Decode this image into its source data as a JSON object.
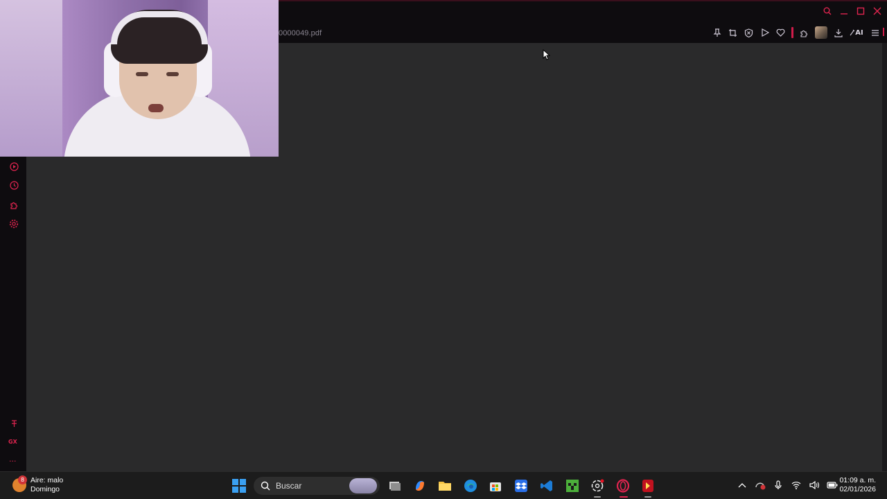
{
  "browser": {
    "address": {
      "url_text": "0000049.pdf"
    },
    "toolbar": {
      "icons": [
        "pin-icon",
        "snapshot-icon",
        "shield-icon",
        "play-icon",
        "heart-icon",
        "extensions-icon",
        "profile-avatar",
        "download-icon"
      ],
      "ai_label": "AI"
    },
    "sidebar": {
      "icons": [
        "player-icon",
        "history-icon",
        "extensions-icon",
        "settings-icon"
      ],
      "bottom_label": "GX",
      "more": "..."
    },
    "accent_color": "#e0244f",
    "viewport_color": "#2a2a2b"
  },
  "taskbar": {
    "weather": {
      "badge": "8",
      "line1": "Aire: malo",
      "line2": "Domingo"
    },
    "search": {
      "placeholder": "Buscar"
    },
    "apps": [
      "task-view",
      "copilot",
      "file-explorer",
      "edge",
      "store",
      "dropbox",
      "code-editor",
      "minecraft",
      "chatgpt",
      "opera-gx",
      "media-app"
    ],
    "clock": {
      "time": "01:09 a. m.",
      "date": "02/01/2026"
    }
  }
}
